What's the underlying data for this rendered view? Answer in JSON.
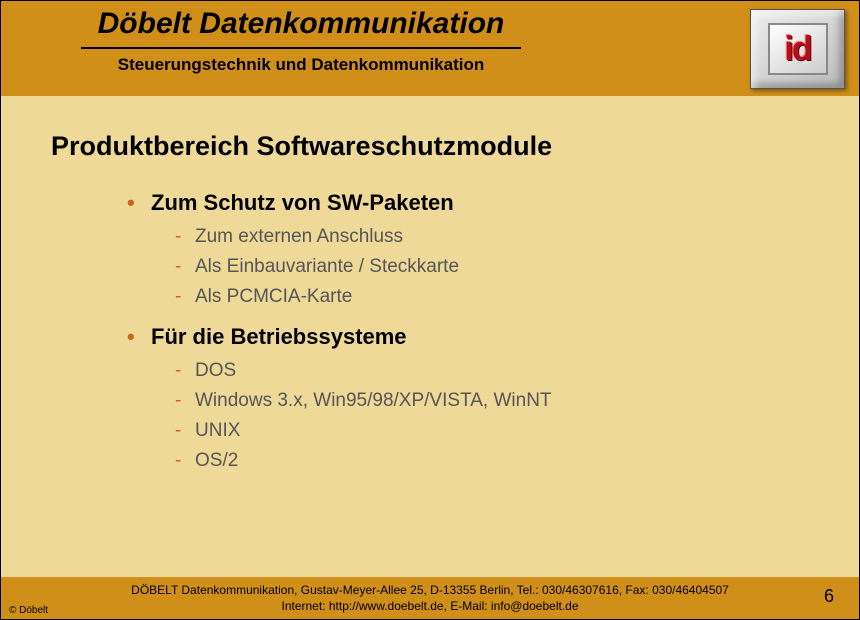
{
  "header": {
    "title": "Döbelt Datenkommunikation",
    "subtitle": "Steuerungstechnik und Datenkommunikation",
    "logo_text": "id"
  },
  "content": {
    "title": "Produktbereich Softwareschutzmodule",
    "sections": [
      {
        "heading": "Zum Schutz von SW-Paketen",
        "items": [
          "Zum externen Anschluss",
          "Als Einbauvariante / Steckkarte",
          "Als PCMCIA-Karte"
        ]
      },
      {
        "heading": "Für die Betriebssysteme",
        "items": [
          "DOS",
          "Windows 3.x, Win95/98/XP/VISTA, WinNT",
          "UNIX",
          "OS/2"
        ]
      }
    ]
  },
  "footer": {
    "copyright": "© Döbelt",
    "line1": "DÖBELT Datenkommunikation, Gustav-Meyer-Allee 25, D-13355 Berlin, Tel.: 030/46307616, Fax: 030/46404507",
    "line2": "Internet: http://www.doebelt.de, E-Mail: info@doebelt.de",
    "page": "6"
  }
}
